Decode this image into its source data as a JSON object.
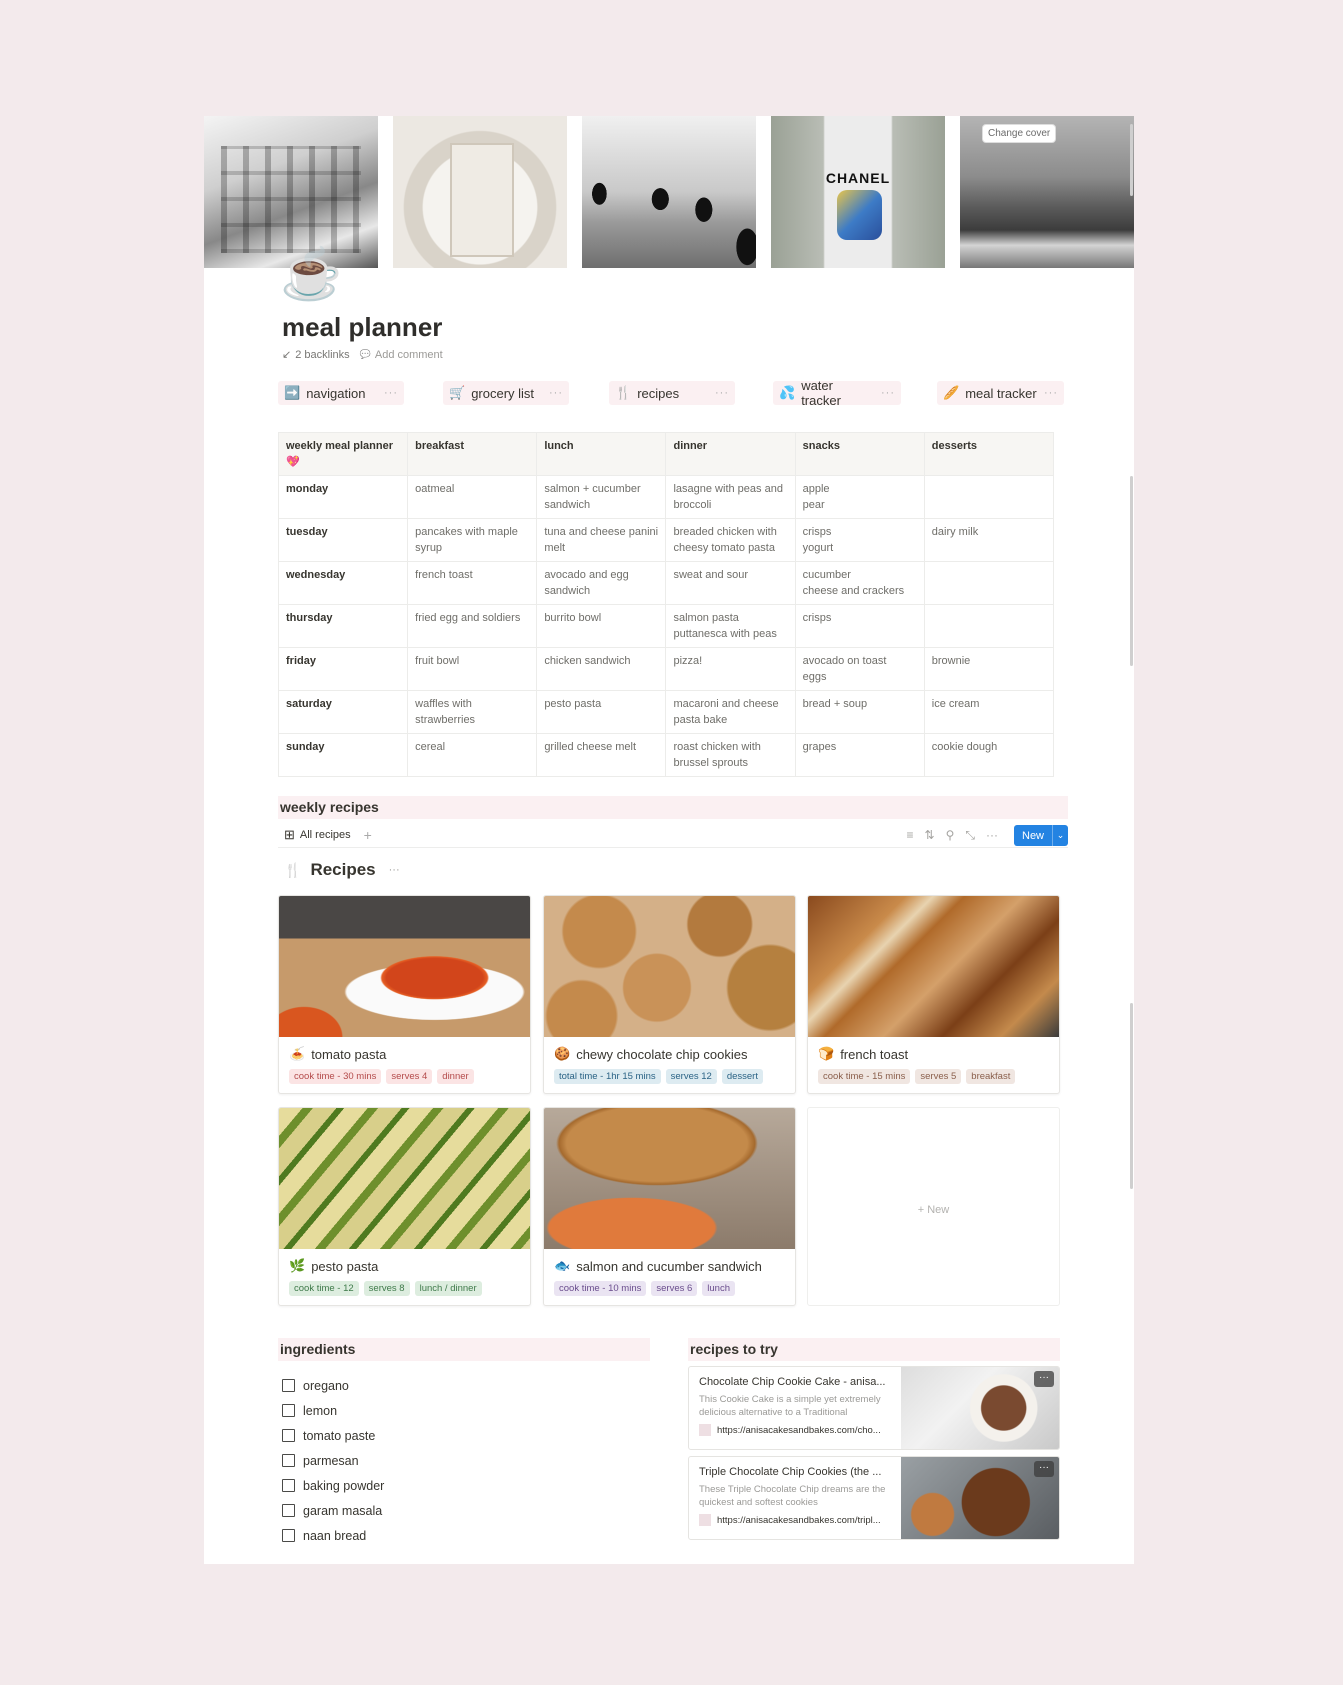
{
  "cover": {
    "change_cover_label": "Change cover",
    "images": [
      "building",
      "menu-plate",
      "palm-trees",
      "chanel-tshirt",
      "yacht"
    ],
    "chanel_text": "CHANEL"
  },
  "page": {
    "icon": "☕",
    "title": "meal planner",
    "backlinks_icon": "↙",
    "backlinks": "2 backlinks",
    "comment_icon": "💬",
    "add_comment": "Add comment"
  },
  "nav_buttons": [
    {
      "icon": "➡️",
      "label": "navigation"
    },
    {
      "icon": "🛒",
      "label": "grocery list"
    },
    {
      "icon": "🍴",
      "label": "recipes"
    },
    {
      "icon": "💦",
      "label": "water tracker"
    },
    {
      "icon": "🥖",
      "label": "meal tracker"
    }
  ],
  "more_label": "···",
  "planner_table": {
    "headers": [
      "weekly meal planner 💖",
      "breakfast",
      "lunch",
      "dinner",
      "snacks",
      "desserts"
    ],
    "rows": [
      [
        "monday",
        "oatmeal",
        "salmon + cucumber sandwich",
        "lasagne with peas and broccoli",
        "apple\npear",
        ""
      ],
      [
        "tuesday",
        "pancakes with maple syrup",
        "tuna and cheese panini melt",
        "breaded chicken with cheesy tomato pasta",
        "crisps\nyogurt",
        "dairy milk"
      ],
      [
        "wednesday",
        "french toast",
        "avocado and egg sandwich",
        "sweat and sour",
        "cucumber\ncheese and crackers",
        ""
      ],
      [
        "thursday",
        "fried egg and soldiers",
        "burrito bowl",
        "salmon pasta puttanesca with peas",
        "crisps",
        ""
      ],
      [
        "friday",
        "fruit bowl",
        "chicken sandwich",
        "pizza!",
        "avocado on toast\neggs",
        "brownie"
      ],
      [
        "saturday",
        "waffles with strawberries",
        "pesto pasta",
        "macaroni and cheese pasta bake",
        "bread + soup",
        "ice cream"
      ],
      [
        "sunday",
        "cereal",
        "grilled cheese melt",
        "roast chicken with brussel sprouts",
        "grapes",
        "cookie dough"
      ]
    ]
  },
  "weekly_recipes": {
    "header": "weekly recipes",
    "view_tab": "All recipes",
    "view_icon": "⊞",
    "add_view": "+",
    "tools": [
      "filter",
      "sort",
      "search",
      "expand",
      "more"
    ],
    "tool_glyphs": [
      "≡",
      "⇅",
      "⚲",
      "⤡",
      "···"
    ],
    "new_label": "New",
    "new_chevron": "⌄",
    "db_icon": "🍴",
    "db_title": "Recipes",
    "db_more": "···",
    "cards": [
      {
        "icon": "🍝",
        "name": "tomato pasta",
        "tags": [
          {
            "text": "cook time - 30 mins",
            "color": "red"
          },
          {
            "text": "serves 4",
            "color": "red"
          },
          {
            "text": "dinner",
            "color": "red"
          }
        ]
      },
      {
        "icon": "🍪",
        "name": "chewy chocolate chip cookies",
        "tags": [
          {
            "text": "total time - 1hr 15 mins",
            "color": "blue"
          },
          {
            "text": "serves 12",
            "color": "blue"
          },
          {
            "text": "dessert",
            "color": "blue"
          }
        ]
      },
      {
        "icon": "🍞",
        "name": "french toast",
        "tags": [
          {
            "text": "cook time - 15 mins",
            "color": "brown"
          },
          {
            "text": "serves 5",
            "color": "brown"
          },
          {
            "text": "breakfast",
            "color": "brown"
          }
        ]
      },
      {
        "icon": "🌿",
        "name": "pesto pasta",
        "tags": [
          {
            "text": "cook time - 12",
            "color": "green"
          },
          {
            "text": "serves 8",
            "color": "green"
          },
          {
            "text": "lunch / dinner",
            "color": "green"
          }
        ]
      },
      {
        "icon": "🐟",
        "name": "salmon and cucumber sandwich",
        "tags": [
          {
            "text": "cook time - 10 mins",
            "color": "purple"
          },
          {
            "text": "serves 6",
            "color": "purple"
          },
          {
            "text": "lunch",
            "color": "purple"
          }
        ]
      }
    ],
    "new_card_label": "+ New"
  },
  "ingredients": {
    "header": "ingredients",
    "items": [
      {
        "label": "oregano",
        "checked": false
      },
      {
        "label": "lemon",
        "checked": false
      },
      {
        "label": "tomato paste",
        "checked": false
      },
      {
        "label": "parmesan",
        "checked": false
      },
      {
        "label": "baking powder",
        "checked": false
      },
      {
        "label": "garam masala",
        "checked": false
      },
      {
        "label": "naan bread",
        "checked": false
      }
    ]
  },
  "recipes_to_try": {
    "header": "recipes to try",
    "bookmarks": [
      {
        "title": "Chocolate Chip Cookie Cake - anisa...",
        "description": "This Cookie Cake is a simple yet extremely delicious alternative to a Traditional",
        "url": "https://anisacakesandbakes.com/cho..."
      },
      {
        "title": "Triple Chocolate Chip Cookies (the ...",
        "description": "These Triple Chocolate Chip dreams are the quickest and softest cookies",
        "url": "https://anisacakesandbakes.com/tripl..."
      }
    ]
  }
}
